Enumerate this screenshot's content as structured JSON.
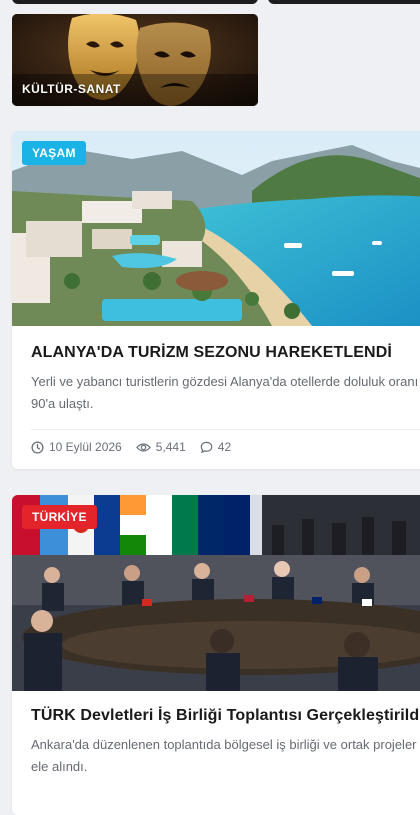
{
  "culture_card": {
    "label": "KÜLTÜR-SANAT"
  },
  "articles": [
    {
      "badge": "YAŞAM",
      "title": "ALANYA'DA TURİZM SEZONU HAREKETLENDİ",
      "excerpt": "Yerli ve yabancı turistlerin gözdesi Alanya'da otellerde doluluk oranı 90'a ulaştı.",
      "date": "10 Eylül 2026",
      "views": "5,441",
      "comments": "42",
      "badge_color": "#19b3e6"
    },
    {
      "badge": "TÜRKİYE",
      "title": "TÜRK Devletleri İş Birliği Toplantısı Gerçekleştirildi",
      "excerpt": "Ankara'da düzenlenen toplantıda bölgesel iş birliği ve ortak projeler ele alındı.",
      "badge_color": "#e3242b"
    }
  ],
  "icons": {
    "date": "clock-icon",
    "views": "eye-icon",
    "comments": "comment-icon"
  }
}
